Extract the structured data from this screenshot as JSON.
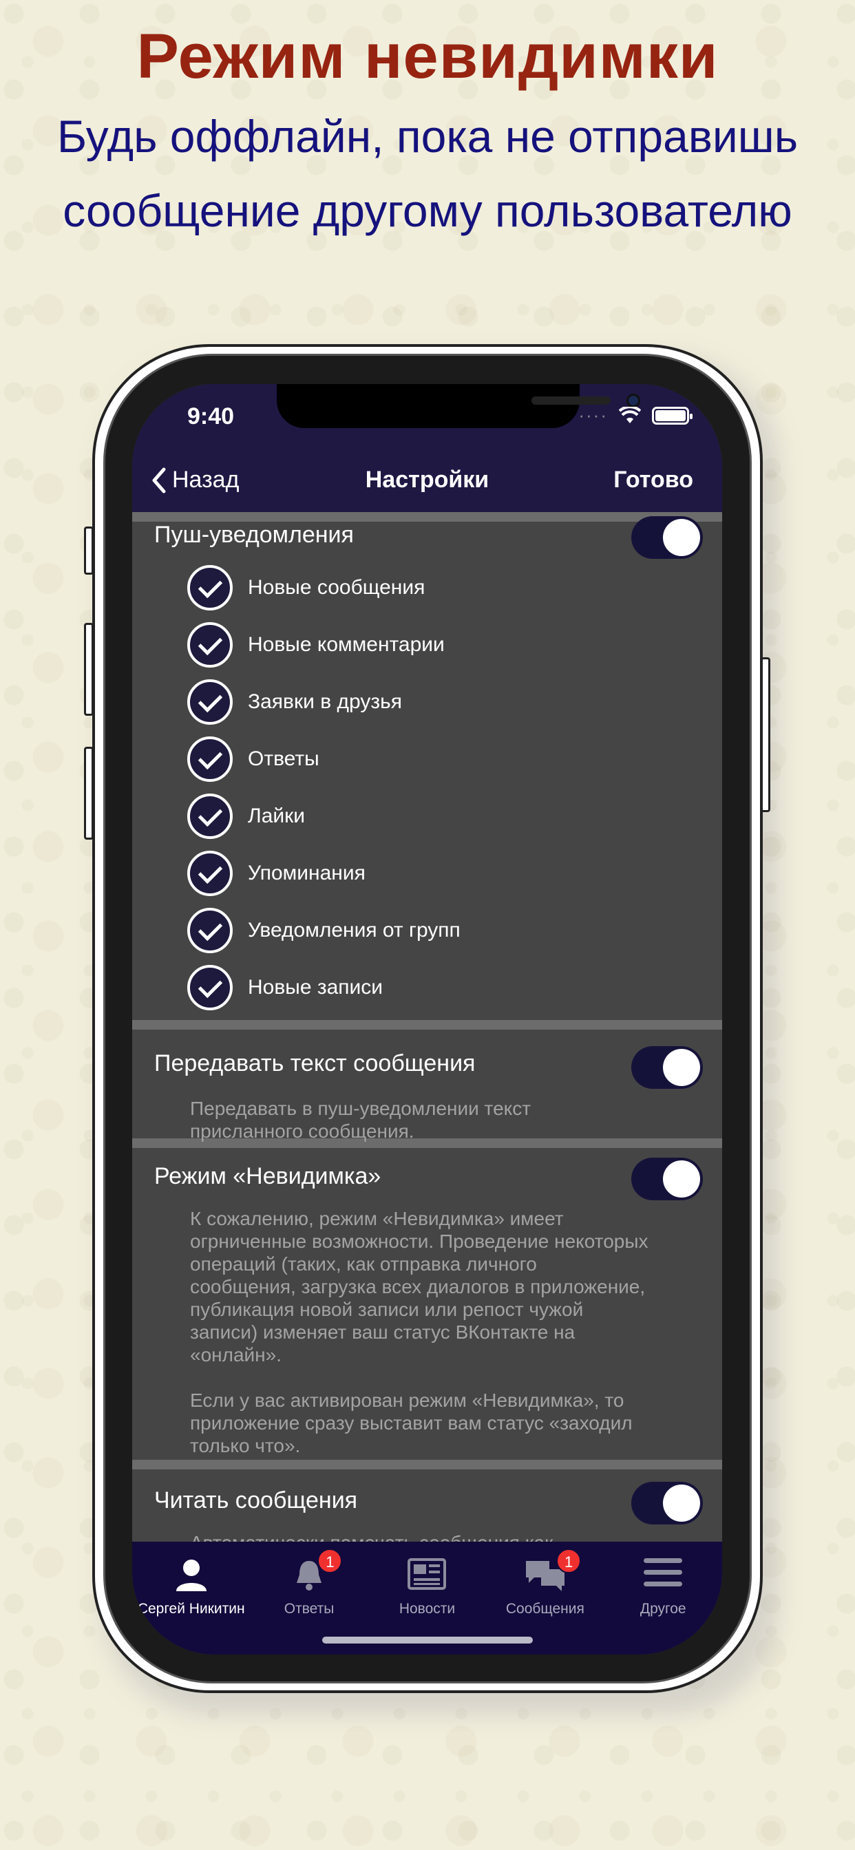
{
  "promo": {
    "title": "Режим невидимки",
    "subtitle_line1": "Будь оффлайн, пока не отправишь",
    "subtitle_line2": "сообщение другому пользователю"
  },
  "status_bar": {
    "time": "9:40",
    "signal": "····"
  },
  "nav": {
    "back_label": "Назад",
    "title": "Настройки",
    "done_label": "Готово"
  },
  "settings": {
    "push": {
      "label": "Пуш-уведомления",
      "enabled": true,
      "items": [
        {
          "label": "Новые сообщения",
          "checked": true
        },
        {
          "label": "Новые комментарии",
          "checked": true
        },
        {
          "label": "Заявки в друзья",
          "checked": true
        },
        {
          "label": "Ответы",
          "checked": true
        },
        {
          "label": "Лайки",
          "checked": true
        },
        {
          "label": "Упоминания",
          "checked": true
        },
        {
          "label": "Уведомления от групп",
          "checked": true
        },
        {
          "label": "Новые записи",
          "checked": true
        }
      ]
    },
    "send_text": {
      "label": "Передавать текст сообщения",
      "enabled": true,
      "desc_line1": "Передавать в пуш-уведомлении текст",
      "desc_line2": "присланного сообщения."
    },
    "invisible": {
      "label": "Режим «Невидимка»",
      "enabled": true,
      "p1_lines": [
        "К сожалению, режим «Невидимка» имеет",
        "огрниченные возможности. Проведение некоторых",
        "операций (таких, как отправка личного",
        "сообщения, загрузка всех диалогов в приложение,",
        "публикация новой записи или репост чужой",
        "записи) изменяет ваш статус ВКонтакте на",
        "«онлайн»."
      ],
      "p2_lines": [
        "Если у вас активирован режим «Невидимка», то",
        "приложение сразу выставит вам статус «заходил",
        "только что»."
      ]
    },
    "read": {
      "label": "Читать сообщения",
      "enabled": true,
      "desc_partial": "Автоматически помечать сообщения как"
    }
  },
  "tabbar": {
    "tabs": [
      {
        "label": "Сергей Никитин",
        "icon": "user-icon",
        "active": true,
        "badge": ""
      },
      {
        "label": "Ответы",
        "icon": "bell-icon",
        "active": false,
        "badge": "1"
      },
      {
        "label": "Новости",
        "icon": "newspaper-icon",
        "active": false,
        "badge": ""
      },
      {
        "label": "Сообщения",
        "icon": "chat-bubbles-icon",
        "active": false,
        "badge": "1"
      },
      {
        "label": "Другое",
        "icon": "menu-icon",
        "active": false,
        "badge": ""
      }
    ]
  },
  "colors": {
    "title": "#962411",
    "subtitle": "#15127d",
    "bar": "#1f1843",
    "tabbar": "#120a3c",
    "toggle_on": "#15123a",
    "badge": "#f0302f"
  }
}
